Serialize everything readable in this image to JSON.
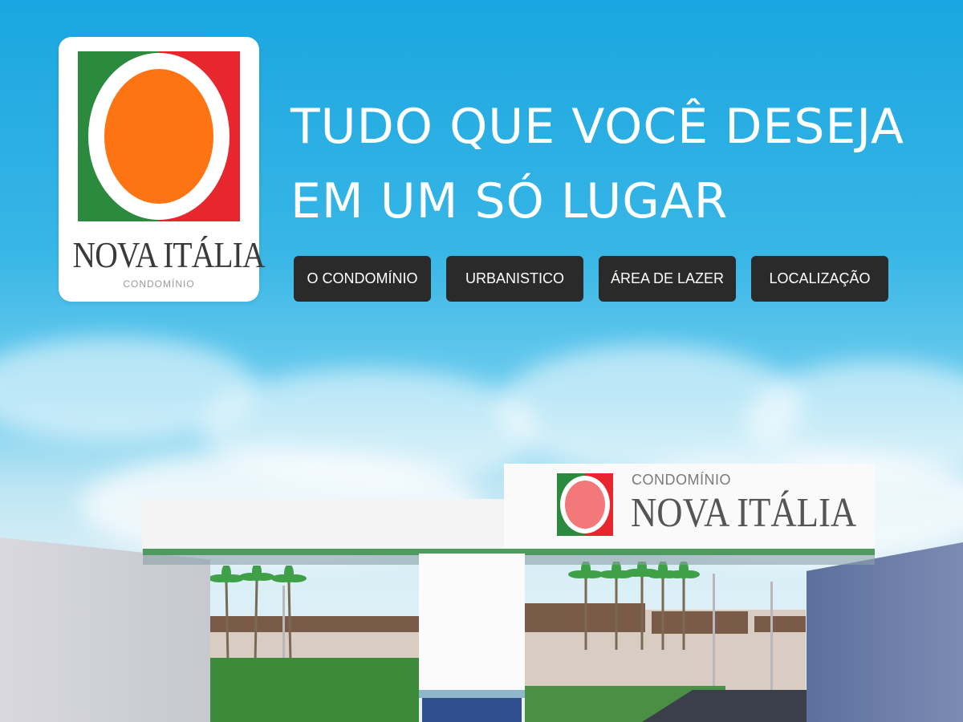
{
  "logo": {
    "name": "NOVA ITÁLIA",
    "subtitle": "CONDOMÍNIO",
    "colors": {
      "green": "#2b8a3e",
      "red": "#e8262e",
      "orange": "#ff7412"
    }
  },
  "headline": {
    "line1": "TUDO QUE VOCÊ DESEJA",
    "line2": "EM UM SÓ LUGAR"
  },
  "nav": [
    {
      "label": "O CONDOMÍNIO"
    },
    {
      "label": "URBANISTICO"
    },
    {
      "label": "ÁREA DE LAZER"
    },
    {
      "label": "LOCALIZAÇÃO"
    }
  ],
  "gate_sign": {
    "subtitle": "CONDOMÍNIO",
    "name": "NOVA ITÁLIA"
  },
  "colors": {
    "sky": "#1aa6e0",
    "button_bg": "#2a2a2a",
    "button_text": "#ffffff"
  }
}
